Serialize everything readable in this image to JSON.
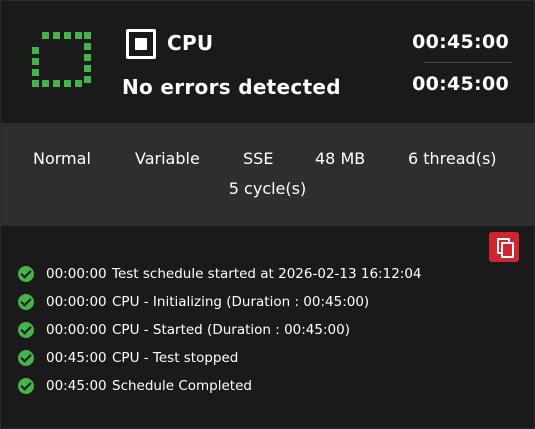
{
  "header": {
    "test_name": "CPU",
    "status": "No errors detected",
    "time_elapsed": "00:45:00",
    "time_total": "00:45:00",
    "status_color": "#43b548"
  },
  "params": {
    "mode": "Normal",
    "load": "Variable",
    "instruction_set": "SSE",
    "memory": "48 MB",
    "threads": "6 thread(s)",
    "cycles": "5 cycle(s)"
  },
  "log": {
    "copy_icon": "copy-icon",
    "copy_color": "#d0252e",
    "entries": [
      {
        "time": "00:00:00",
        "message": "Test schedule started at 2026-02-13 16:12:04"
      },
      {
        "time": "00:00:00",
        "message": "CPU - Initializing (Duration : 00:45:00)"
      },
      {
        "time": "00:00:00",
        "message": "CPU - Started (Duration : 00:45:00)"
      },
      {
        "time": "00:45:00",
        "message": "CPU - Test stopped"
      },
      {
        "time": "00:45:00",
        "message": "Schedule Completed"
      }
    ]
  }
}
